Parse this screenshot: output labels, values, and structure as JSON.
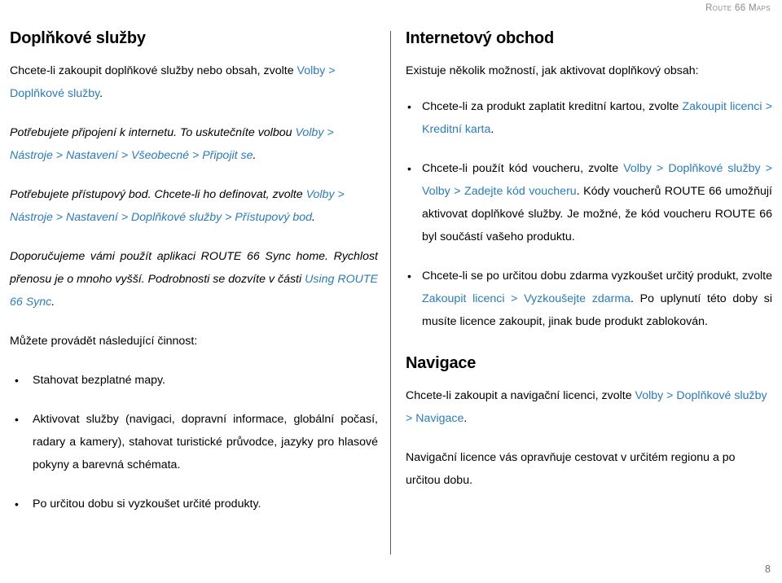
{
  "header": {
    "running_title": "Route 66 Maps"
  },
  "footer": {
    "page_number": "8"
  },
  "colors": {
    "link_blue": "#2b7cb5",
    "header_gray": "#8a8a8a",
    "body_black": "#000000"
  },
  "left_column": {
    "title": "Doplňkové služby",
    "paragraph_1": {
      "text_before": "Chcete-li zakoupit doplňkové služby nebo obsah, zvolte ",
      "link": "Volby > Doplňkové služby",
      "text_after": "."
    },
    "paragraph_2": {
      "text_before": "Potřebujete připojení k internetu. To uskutečníte volbou ",
      "link": "Volby > Nástroje > Nastavení > Všeobecné > Připojit se",
      "text_after": "."
    },
    "paragraph_3": {
      "text_before": "Potřebujete přístupový bod. Chcete-li ho definovat, zvolte ",
      "link": "Volby > Nástroje > Nastavení > Doplňkové služby > Přístupový bod",
      "text_after": "."
    },
    "paragraph_4": {
      "text_before": "Doporučujeme vámi použít aplikaci ROUTE 66 Sync home. Rychlost přenosu je o mnoho vyšší. Podrobnosti se dozvíte v části ",
      "link": "Using ROUTE 66 Sync",
      "text_after": "."
    },
    "paragraph_5": {
      "text": "Můžete provádět následující činnost:"
    },
    "bullets": [
      {
        "text": "Stahovat bezplatné mapy."
      },
      {
        "text": "Aktivovat služby (navigaci, dopravní informace, globální počasí, radary a kamery), stahovat turistické průvodce, jazyky pro hlasové pokyny a barevná schémata."
      },
      {
        "text": "Po určitou dobu si vyzkoušet určité produkty."
      }
    ]
  },
  "right_column": {
    "title": "Internetový obchod",
    "intro": "Existuje několik možností, jak aktivovat doplňkový obsah:",
    "bullets": [
      {
        "text_before": "Chcete-li za produkt zaplatit kreditní kartou, zvolte ",
        "link": "Zakoupit licenci > Kreditní karta",
        "text_after": "."
      },
      {
        "text_before": "Chcete-li použít kód voucheru, zvolte ",
        "link": "Volby > Doplňkové služby > Volby > Zadejte kód voucheru",
        "text_after": ". Kódy voucherů ROUTE 66 umožňují aktivovat doplňkové služby. Je možné, že kód voucheru ROUTE 66 byl součástí vašeho produktu."
      },
      {
        "text_before": "Chcete-li se po určitou dobu zdarma vyzkoušet určitý produkt, zvolte ",
        "link": "Zakoupit licenci > Vyzkoušejte zdarma",
        "text_after": ". Po uplynutí této doby si musíte licence zakoupit, jinak bude produkt zablokován."
      }
    ],
    "navigation_title": "Navigace",
    "navigation_paragraph_1": {
      "text_before": "Chcete-li zakoupit a navigační licenci, zvolte ",
      "link": "Volby > Doplňkové služby > Navigace",
      "text_after": "."
    },
    "navigation_paragraph_2": {
      "text": "Navigační licence vás opravňuje cestovat v určitém regionu a po určitou dobu."
    }
  },
  "bullet_glyph": "•"
}
